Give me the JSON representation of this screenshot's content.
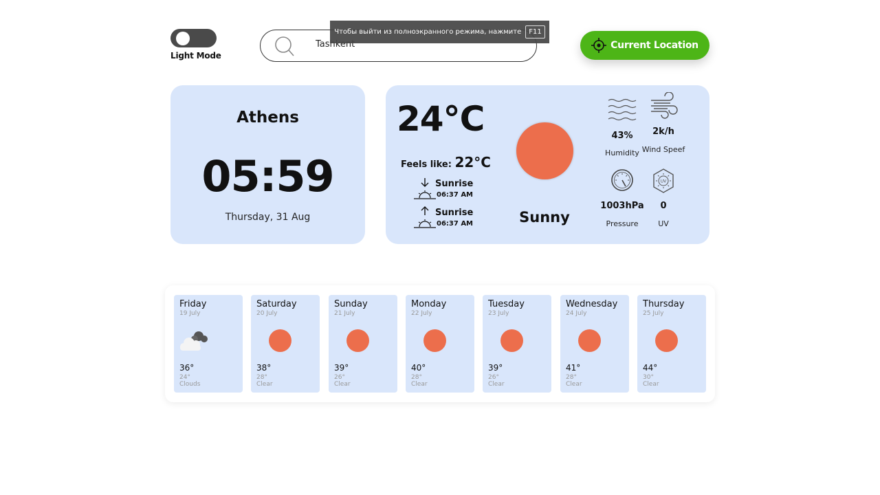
{
  "theme_toggle": {
    "label": "Light Mode"
  },
  "search": {
    "value": "Tashkent",
    "placeholder": ""
  },
  "fullscreen_notice": {
    "text": "Чтобы выйти из полноэкранного режима, нажмите",
    "key": "F11"
  },
  "location_button": {
    "label": "Current Location"
  },
  "city_card": {
    "city": "Athens",
    "time": "05:59",
    "date": "Thursday, 31 Aug"
  },
  "weather": {
    "temperature": "24°C",
    "feels_like_label": "Feels like:",
    "feels_like_value": "22°C",
    "sunrise": {
      "label": "Sunrise",
      "time": "06:37 AM"
    },
    "sunset": {
      "label": "Sunrise",
      "time": "06:37 AM"
    },
    "condition": "Sunny",
    "humidity": {
      "value": "43%",
      "label": "Humidity"
    },
    "wind": {
      "value": "2k/h",
      "label": "Wind Speef"
    },
    "pressure": {
      "value": "1003hPa",
      "label": "Pressure"
    },
    "uv": {
      "value": "0",
      "label": "UV"
    }
  },
  "forecast": [
    {
      "day": "Friday",
      "date": "19 July",
      "high": "36°",
      "low": "24°",
      "desc": "Clouds",
      "icon": "clouds-icon"
    },
    {
      "day": "Saturday",
      "date": "20 July",
      "high": "38°",
      "low": "28°",
      "desc": "Clear",
      "icon": "sun-icon"
    },
    {
      "day": "Sunday",
      "date": "21 July",
      "high": "39°",
      "low": "26°",
      "desc": "Clear",
      "icon": "sun-icon"
    },
    {
      "day": "Monday",
      "date": "22 July",
      "high": "40°",
      "low": "28°",
      "desc": "Clear",
      "icon": "sun-icon"
    },
    {
      "day": "Tuesday",
      "date": "23 July",
      "high": "39°",
      "low": "26°",
      "desc": "Clear",
      "icon": "sun-icon"
    },
    {
      "day": "Wednesday",
      "date": "24 July",
      "high": "41°",
      "low": "28°",
      "desc": "Clear",
      "icon": "sun-icon"
    },
    {
      "day": "Thursday",
      "date": "25 July",
      "high": "44°",
      "low": "30°",
      "desc": "Clear",
      "icon": "sun-icon"
    }
  ],
  "colors": {
    "card_bg": "#d9e6fb",
    "sun": "#ec6e4c",
    "accent_green": "#4db517",
    "toggle": "#4a4a4a"
  }
}
